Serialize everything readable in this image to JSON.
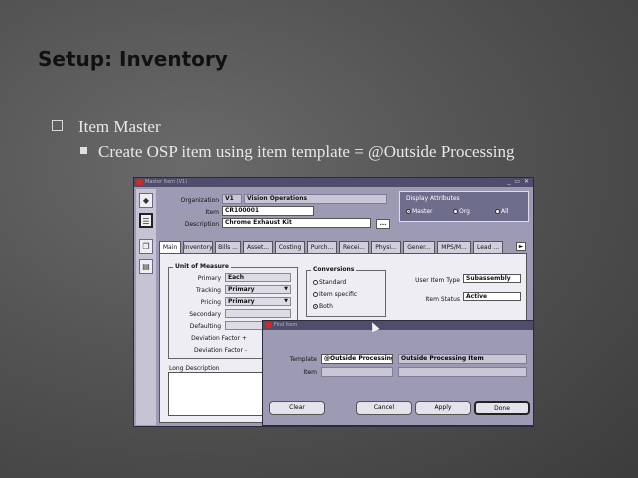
{
  "slide": {
    "title": "Setup: Inventory",
    "bullet1": "Item Master",
    "bullet2": "Create OSP item using item template = @Outside Processing"
  },
  "window": {
    "title": "Master Item (V1)",
    "controls": "_ ▭ ✕",
    "organization_label": "Organization",
    "organization_code": "V1",
    "organization_name": "Vision Operations",
    "item_label": "Item",
    "item_value": "CR100001",
    "description_label": "Description",
    "description_value": "Chrome Exhaust Kit",
    "desc_button": "...",
    "display_attributes": {
      "header": "Display Attributes",
      "options": [
        "Master",
        "Org",
        "All"
      ],
      "selected": "Master"
    },
    "tabs": [
      "Main",
      "Inventory",
      "Bills ...",
      "Asset...",
      "Costing",
      "Purch...",
      "Recei...",
      "Physi...",
      "Gener...",
      "MPS/M...",
      "Lead ..."
    ],
    "active_tab": "Main",
    "tab_arrow": "►",
    "unit_of_measure": {
      "header": "Unit of Measure",
      "primary_label": "Primary",
      "primary_value": "Each",
      "tracking_label": "Tracking",
      "tracking_value": "Primary",
      "pricing_label": "Pricing",
      "pricing_value": "Primary",
      "secondary_label": "Secondary",
      "defaulting_label": "Defaulting",
      "dev_plus_label": "Deviation Factor +",
      "dev_minus_label": "Deviation Factor -"
    },
    "conversions": {
      "header": "Conversions",
      "options": [
        "Standard",
        "Item specific",
        "Both"
      ],
      "selected": "Both"
    },
    "user_item_type_label": "User Item Type",
    "user_item_type_value": "Subassembly",
    "item_status_label": "Item Status",
    "item_status_value": "Active",
    "long_description_label": "Long Description"
  },
  "dialog": {
    "title": "Find Item",
    "template_label": "Template",
    "template_value": "@Outside Processing",
    "template_desc": "Outside Processing Item",
    "item_label": "Item",
    "buttons": {
      "clear": "Clear",
      "cancel": "Cancel",
      "apply": "Apply",
      "done": "Done"
    }
  }
}
